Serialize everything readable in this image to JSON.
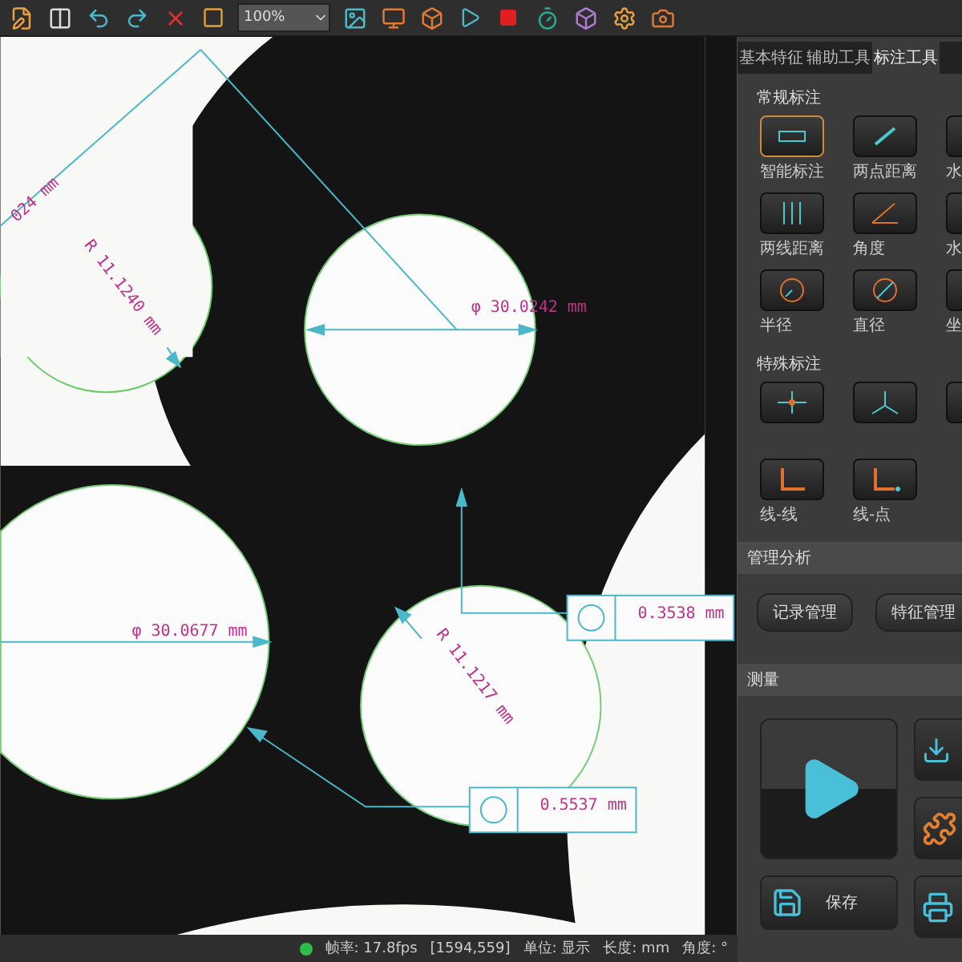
{
  "toolbar": {
    "zoom": "100%"
  },
  "canvas": {
    "annotations": [
      {
        "kind": "diameter",
        "text": "φ 30.0242 mm"
      },
      {
        "kind": "cut",
        "text": "024 mm"
      },
      {
        "kind": "radius",
        "text": "R 11.1240 mm"
      },
      {
        "kind": "diameter",
        "text": "φ 30.0677 mm"
      },
      {
        "kind": "radius",
        "text": "R 11.1217 mm"
      },
      {
        "kind": "roundness",
        "text": "0.3538 mm"
      },
      {
        "kind": "roundness",
        "text": "0.5537 mm"
      }
    ]
  },
  "panel": {
    "tabs": [
      {
        "label": "基本特征",
        "selected": false
      },
      {
        "label": "辅助工具",
        "selected": false
      },
      {
        "label": "标注工具",
        "selected": true
      }
    ],
    "sections": [
      {
        "title": "常规标注",
        "tools": [
          {
            "kind": "smart",
            "label": "智能标注",
            "selected": true
          },
          {
            "kind": "two-point",
            "label": "两点距离",
            "selected": false
          },
          {
            "kind": "horizontal",
            "label": "水",
            "selected": false
          },
          {
            "kind": "two-line",
            "label": "两线距离",
            "selected": false
          },
          {
            "kind": "angle",
            "label": "角度",
            "selected": false
          },
          {
            "kind": "horizontal",
            "label": "水",
            "selected": false
          },
          {
            "kind": "radius",
            "label": "半径",
            "selected": false
          },
          {
            "kind": "diameter",
            "label": "直径",
            "selected": false
          },
          {
            "kind": "coord",
            "label": "坐",
            "selected": false
          }
        ]
      },
      {
        "title": "特殊标注",
        "tools": [
          {
            "kind": "point",
            "selected": false
          },
          {
            "kind": "base",
            "selected": false
          },
          {
            "kind": "base",
            "selected": false
          },
          {
            "kind": "line-line",
            "label": "线-线",
            "selected": false
          },
          {
            "kind": "line-point",
            "label": "线-点",
            "selected": false
          }
        ]
      }
    ],
    "manage": {
      "title": "管理分析",
      "buttons": [
        "记录管理",
        "特征管理"
      ]
    },
    "measure": {
      "title": "测量",
      "save": "保存"
    }
  },
  "status_bar": {
    "fps": "帧率: 17.8fps",
    "position": "[1594,559]",
    "unit": "单位: 显示",
    "length": "长度: mm",
    "angle": "角度: °"
  }
}
